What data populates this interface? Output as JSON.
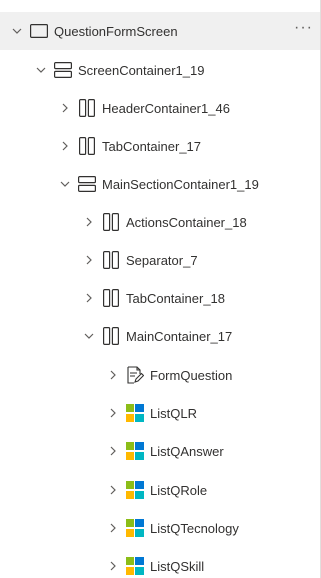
{
  "tree": {
    "root": {
      "label": "QuestionFormScreen",
      "expanded": true,
      "icon": "screen-icon",
      "more_label": "···"
    },
    "items": [
      {
        "label": "ScreenContainer1_19",
        "expanded": true,
        "icon": "vertical-container-icon"
      },
      {
        "label": "HeaderContainer1_46",
        "expanded": false,
        "icon": "horizontal-container-icon"
      },
      {
        "label": "TabContainer_17",
        "expanded": false,
        "icon": "horizontal-container-icon"
      },
      {
        "label": "MainSectionContainer1_19",
        "expanded": true,
        "icon": "vertical-container-icon"
      },
      {
        "label": "ActionsContainer_18",
        "expanded": false,
        "icon": "horizontal-container-icon"
      },
      {
        "label": "Separator_7",
        "expanded": false,
        "icon": "horizontal-container-icon"
      },
      {
        "label": "TabContainer_18",
        "expanded": false,
        "icon": "horizontal-container-icon"
      },
      {
        "label": "MainContainer_17",
        "expanded": true,
        "icon": "horizontal-container-icon"
      },
      {
        "label": "FormQuestion",
        "expanded": false,
        "icon": "form-edit-icon"
      },
      {
        "label": "ListQLR",
        "expanded": false,
        "icon": "gallery-icon"
      },
      {
        "label": "ListQAnswer",
        "expanded": false,
        "icon": "gallery-icon"
      },
      {
        "label": "ListQRole",
        "expanded": false,
        "icon": "gallery-icon"
      },
      {
        "label": "ListQTecnology",
        "expanded": false,
        "icon": "gallery-icon"
      },
      {
        "label": "ListQSkill",
        "expanded": false,
        "icon": "gallery-icon"
      }
    ]
  },
  "colors": {
    "selected_row": "#f0f0f0",
    "text": "#323130",
    "icon_stroke": "#323130",
    "gallery_green": "#8cbd18",
    "gallery_blue": "#0078d4",
    "gallery_yellow": "#ffb900",
    "gallery_teal": "#00b7c3"
  }
}
